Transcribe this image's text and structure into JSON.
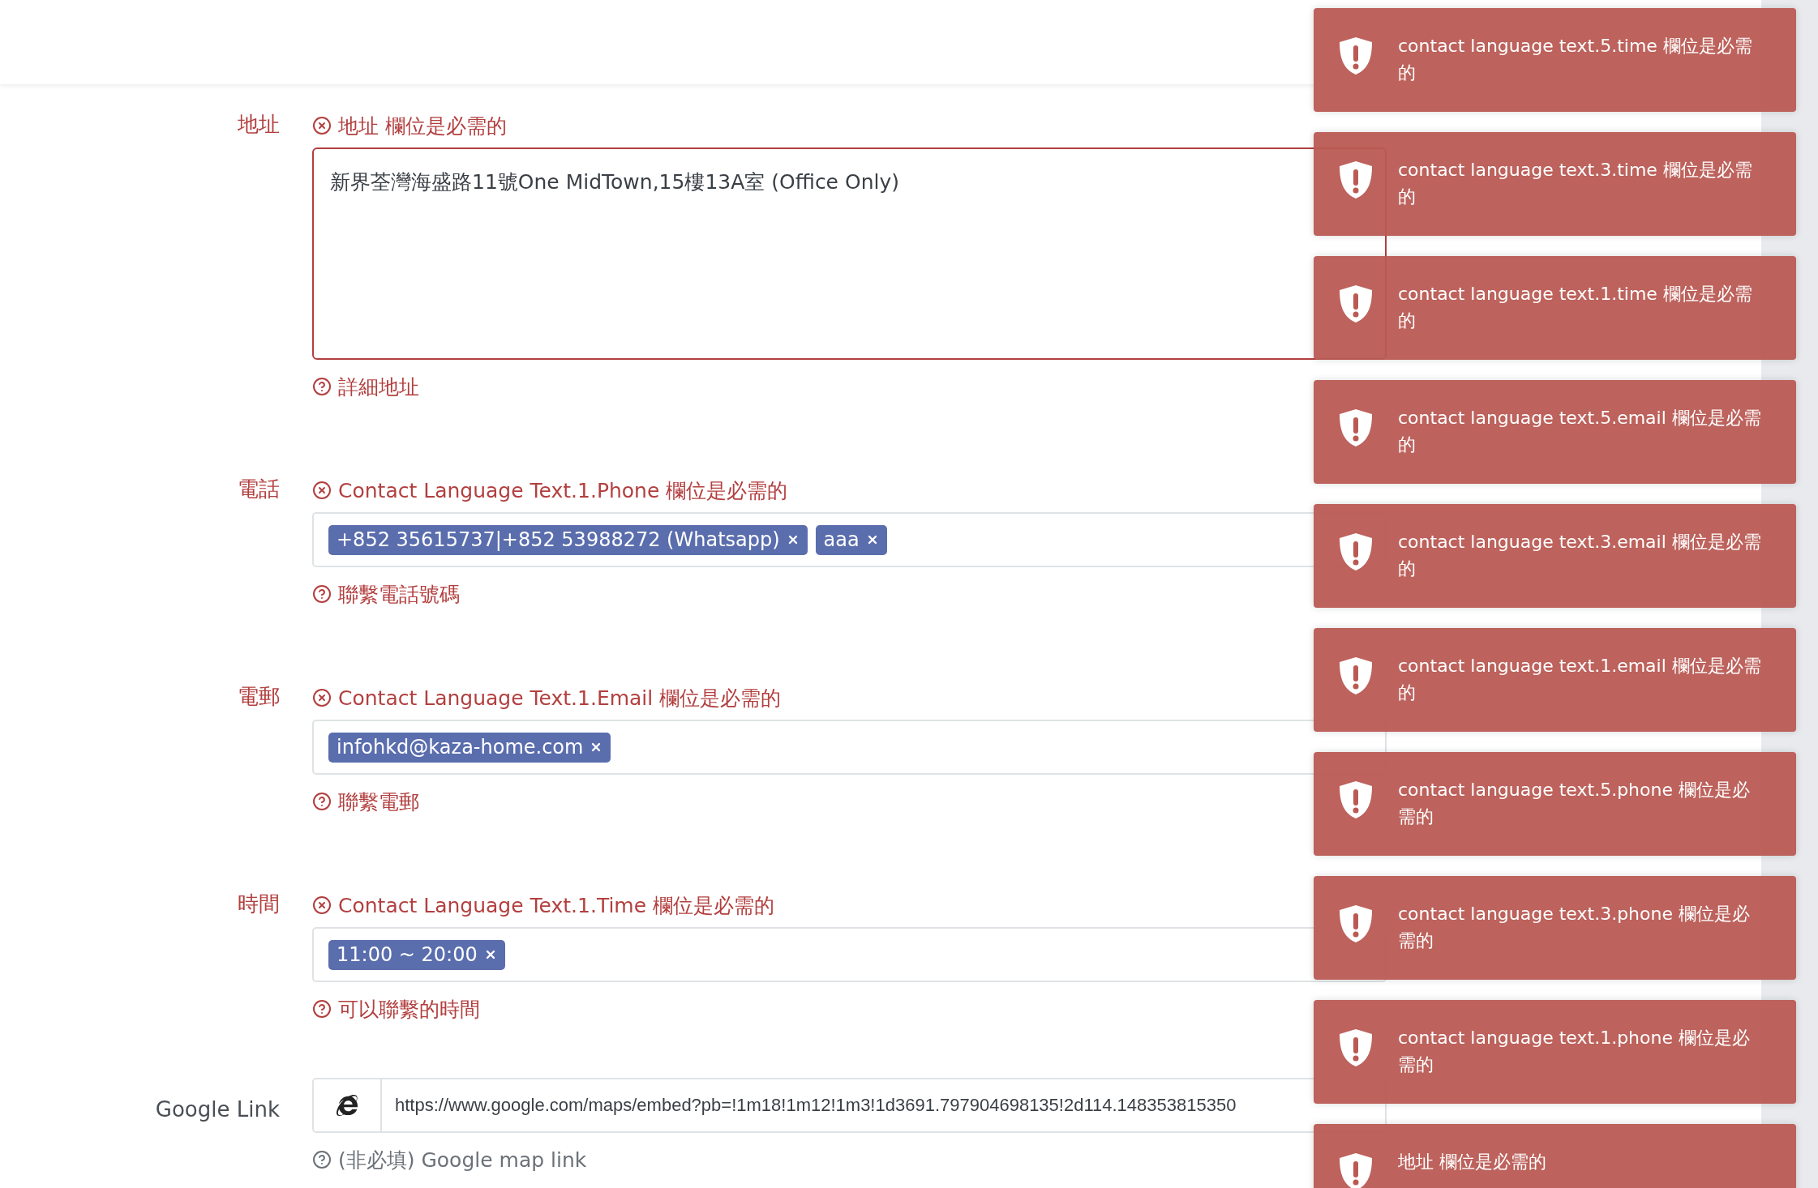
{
  "fields": [
    {
      "kind": "textarea",
      "label": "地址",
      "invalid": true,
      "error": "地址 欄位是必需的",
      "value": "新界荃灣海盛路11號One MidTown,15樓13A室 (Office Only)",
      "help": "詳細地址"
    },
    {
      "kind": "tags",
      "label": "電話",
      "invalid": true,
      "error": "Contact Language Text.1.Phone 欄位是必需的",
      "tags": [
        "+852 35615737|+852 53988272 (Whatsapp)",
        "aaa"
      ],
      "help": "聯繫電話號碼"
    },
    {
      "kind": "tags",
      "label": "電郵",
      "invalid": true,
      "error": "Contact Language Text.1.Email 欄位是必需的",
      "tags": [
        "infohkd@kaza-home.com"
      ],
      "help": "聯繫電郵"
    },
    {
      "kind": "tags",
      "label": "時間",
      "invalid": true,
      "error": "Contact Language Text.1.Time 欄位是必需的",
      "tags": [
        "11:00 ~ 20:00"
      ],
      "help": "可以聯繫的時間"
    },
    {
      "kind": "addon",
      "label": "Google Link",
      "invalid": false,
      "value": "https://www.google.com/maps/embed?pb=!1m18!1m12!1m3!1d3691.797904698135!2d114.148353815350",
      "help": "(非必填) Google map link"
    }
  ],
  "toasts": [
    {
      "message": "contact language text.5.time 欄位是必需的"
    },
    {
      "message": "contact language text.3.time 欄位是必需的"
    },
    {
      "message": "contact language text.1.time 欄位是必需的"
    },
    {
      "message": "contact language text.5.email 欄位是必需的"
    },
    {
      "message": "contact language text.3.email 欄位是必需的"
    },
    {
      "message": "contact language text.1.email 欄位是必需的"
    },
    {
      "message": "contact language text.5.phone 欄位是必需的"
    },
    {
      "message": "contact language text.3.phone 欄位是必需的"
    },
    {
      "message": "contact language text.1.phone 欄位是必需的"
    },
    {
      "message": "地址 欄位是必需的"
    }
  ]
}
